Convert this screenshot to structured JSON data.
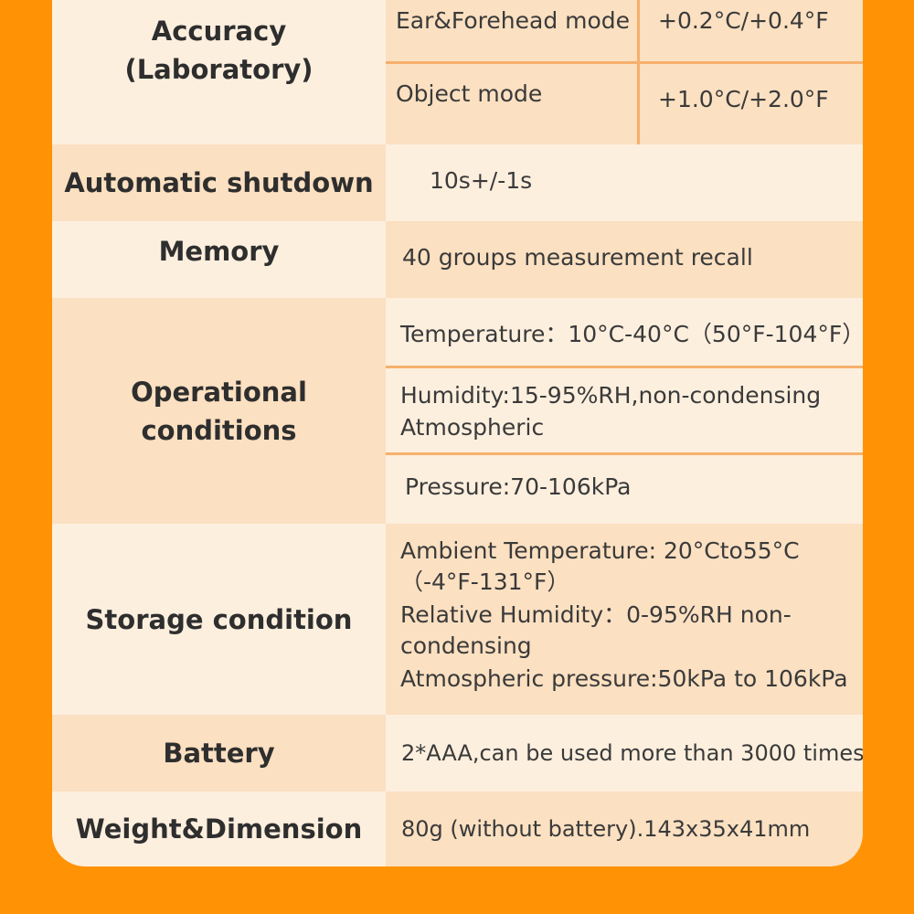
{
  "specs": {
    "accuracy": {
      "label_line1": "Accuracy",
      "label_line2": "(Laboratory)",
      "rows": [
        {
          "mode": "Ear&Forehead mode",
          "value": "+0.2°C/+0.4°F"
        },
        {
          "mode": "Object mode",
          "value": "+1.0°C/+2.0°F"
        }
      ]
    },
    "shutdown": {
      "label": "Automatic shutdown",
      "value": "10s+/-1s"
    },
    "memory": {
      "label": "Memory",
      "value": "40 groups measurement recall"
    },
    "operational": {
      "label_line1": "Operational",
      "label_line2": "conditions",
      "temperature": "Temperature：10°C-40°C（50°F-104°F）",
      "humidity_line1": "Humidity:15-95%RH,non-condensing",
      "humidity_line2": "Atmospheric",
      "pressure": "Pressure:70-106kPa"
    },
    "storage": {
      "label": "Storage condition",
      "line1": "Ambient Temperature: 20°Cto55°C",
      "line2": "（-4°F-131°F）",
      "line3": "Relative Humidity：0-95%RH non-",
      "line4": "condensing",
      "line5": "Atmospheric pressure:50kPa to 106kPa"
    },
    "battery": {
      "label": "Battery",
      "value": "2*AAA,can be used more than 3000 times"
    },
    "weight": {
      "label": "Weight&Dimension",
      "value": "80g (without battery).143x35x41mm"
    }
  }
}
